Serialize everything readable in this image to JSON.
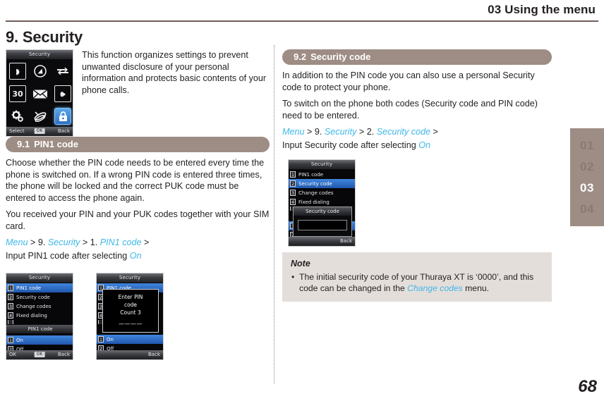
{
  "header": {
    "title": "03 Using the menu"
  },
  "chapter": {
    "title": "9. Security"
  },
  "intro": {
    "text": "This function organizes settings to prevent unwanted disclosure of your personal information and protects basic contents of your phone calls."
  },
  "phone_main": {
    "titlebar": "Security",
    "icons": [
      {
        "name": "sim-card-icon",
        "glyph": "◗"
      },
      {
        "name": "compass-icon",
        "glyph": "✵"
      },
      {
        "name": "call-divert-icon",
        "glyph": "↺"
      },
      {
        "name": "calendar-icon",
        "glyph": "30"
      },
      {
        "name": "message-icon",
        "glyph": "✉"
      },
      {
        "name": "sound-profile-icon",
        "glyph": "◉"
      },
      {
        "name": "settings-gear-icon",
        "glyph": "⚙"
      },
      {
        "name": "satellite-icon",
        "glyph": "☈"
      },
      {
        "name": "security-lock-icon",
        "glyph": "ὑ2"
      }
    ],
    "softkeys": {
      "left": "Select",
      "middle": "OK",
      "right": "Back"
    }
  },
  "section_91": {
    "number": "9.1",
    "title": "PIN1 code",
    "paragraphs": [
      "Choose whether the PIN code needs to be entered every time the phone is switched on.  If a wrong PIN code is entered three times, the phone will be locked and the correct PUK code must be entered to access the phone again.",
      "You received your PIN and your PUK codes together with your SIM card."
    ],
    "path_parts": {
      "p1": "Menu",
      "sep1": " > 9. ",
      "p2": "Security",
      "sep2": " > 1. ",
      "p3": "PIN1 code",
      "sep3": " >"
    },
    "input_line": {
      "pre": "Input PIN1 code after selecting ",
      "value": "On"
    }
  },
  "phone_pin_list": {
    "titlebar": "Security",
    "rows": [
      {
        "num": "1",
        "label": "PIN1 code",
        "selected": true
      },
      {
        "num": "2",
        "label": "Security code",
        "selected": false
      },
      {
        "num": "3",
        "label": "Change codes",
        "selected": false
      },
      {
        "num": "4",
        "label": "Fixed dialing",
        "selected": false
      }
    ],
    "sublabel": "PIN1 code",
    "options": [
      {
        "num": "1",
        "label": "On",
        "selected": true
      },
      {
        "num": "2",
        "label": "Off",
        "selected": false
      }
    ],
    "softkeys": {
      "left": "OK",
      "middle": "OK",
      "right": "Back"
    }
  },
  "phone_pin_dialog": {
    "titlebar": "Security",
    "rows": [
      {
        "num": "1",
        "label": "PIN1 code",
        "selected": true
      },
      {
        "num": "2",
        "label": "Security code",
        "selected": false
      },
      {
        "num": "3",
        "label": "Change codes",
        "selected": false
      },
      {
        "num": "4",
        "label": "Fixed dialing",
        "selected": false
      }
    ],
    "dialog": {
      "line1": "Enter PIN",
      "line2": "code",
      "line3": "Count  3",
      "dashes": "————"
    },
    "options": [
      {
        "num": "1",
        "label": "On",
        "selected": true
      },
      {
        "num": "2",
        "label": "Off",
        "selected": false
      }
    ],
    "softkeys": {
      "left": "",
      "middle": "",
      "right": "Back"
    }
  },
  "section_92": {
    "number": "9.2",
    "title": "Security code",
    "paragraphs": [
      "In addition to the PIN code you can also use a personal Security code to protect your phone.",
      "To switch on the phone both codes (Security code and PIN code) need to be entered."
    ],
    "path_parts": {
      "p1": "Menu",
      "sep1": " > 9. ",
      "p2": "Security",
      "sep2": " > 2. ",
      "p3": "Security code",
      "sep3": " >"
    },
    "input_line": {
      "pre": "Input Security code after selecting ",
      "value": "On"
    }
  },
  "phone_sec_code": {
    "titlebar": "Security",
    "rows": [
      {
        "num": "1",
        "label": "PIN1 code",
        "selected": false
      },
      {
        "num": "2",
        "label": "Security code",
        "selected": true
      },
      {
        "num": "3",
        "label": "Change codes",
        "selected": false
      },
      {
        "num": "4",
        "label": "Fixed dialing",
        "selected": false
      }
    ],
    "dialog_title": "Security code",
    "options": [
      {
        "num": "1",
        "label": "",
        "selected": true
      },
      {
        "num": "2",
        "label": "",
        "selected": false
      }
    ],
    "softkeys": {
      "left": "",
      "middle": "",
      "right": "Back"
    }
  },
  "note": {
    "title": "Note",
    "bullet": "•",
    "text_pre": "The initial security code of your Thuraya XT is ‘0000’, and this code can be changed in the ",
    "link": "Change codes",
    "text_post": " menu."
  },
  "chapter_tabs": {
    "items": [
      {
        "label": "01",
        "active": false
      },
      {
        "label": "02",
        "active": false
      },
      {
        "label": "03",
        "active": true
      },
      {
        "label": "04",
        "active": false
      }
    ]
  },
  "page_number": "68",
  "colors": {
    "accent_bar": "#9d8d85",
    "nav_link": "#3fb7e8",
    "note_bg": "#e4dedb",
    "rule": "#6e5f5a",
    "text": "#231f20"
  }
}
